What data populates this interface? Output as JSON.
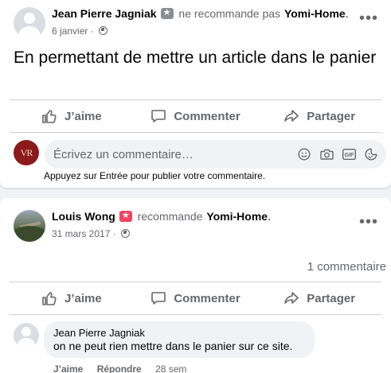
{
  "post1": {
    "author": "Jean Pierre Jagniak",
    "badge_glyph": "★",
    "verb": "ne recommande pas",
    "page": "Yomi-Home",
    "period": ".",
    "date": "6 janvier",
    "separator": "·",
    "more_glyph": "•••",
    "text": "En permettant de mettre un article dans le panier",
    "actions": {
      "like": "J’aime",
      "comment": "Commenter",
      "share": "Partager"
    },
    "composer": {
      "logo_text": "VR",
      "placeholder": "Écrivez un commentaire…",
      "icons": [
        "emoji-icon",
        "camera-icon",
        "gif-icon",
        "sticker-icon"
      ],
      "gif_label": "GIF",
      "hint": "Appuyez sur Entrée pour publier votre commentaire."
    }
  },
  "post2": {
    "author": "Louis Wong",
    "badge_glyph": "★",
    "verb": "recommande",
    "page": "Yomi-Home",
    "period": ".",
    "date": "31 mars 2017",
    "separator": "·",
    "more_glyph": "•••",
    "comment_count": "1 commentaire",
    "actions": {
      "like": "J’aime",
      "comment": "Commenter",
      "share": "Partager"
    },
    "comment": {
      "author": "Jean Pierre Jagniak",
      "text": "on ne peut rien mettre dans le panier sur ce site.",
      "like": "J’aime",
      "reply": "Répondre",
      "age": "28 sem"
    }
  },
  "colors": {
    "background": "#f0f2f5",
    "secondary_text": "#65676b",
    "not_recommend_badge": "#8a8d91",
    "recommend_badge": "#f3425f",
    "logo_red": "#8b1a1a"
  }
}
